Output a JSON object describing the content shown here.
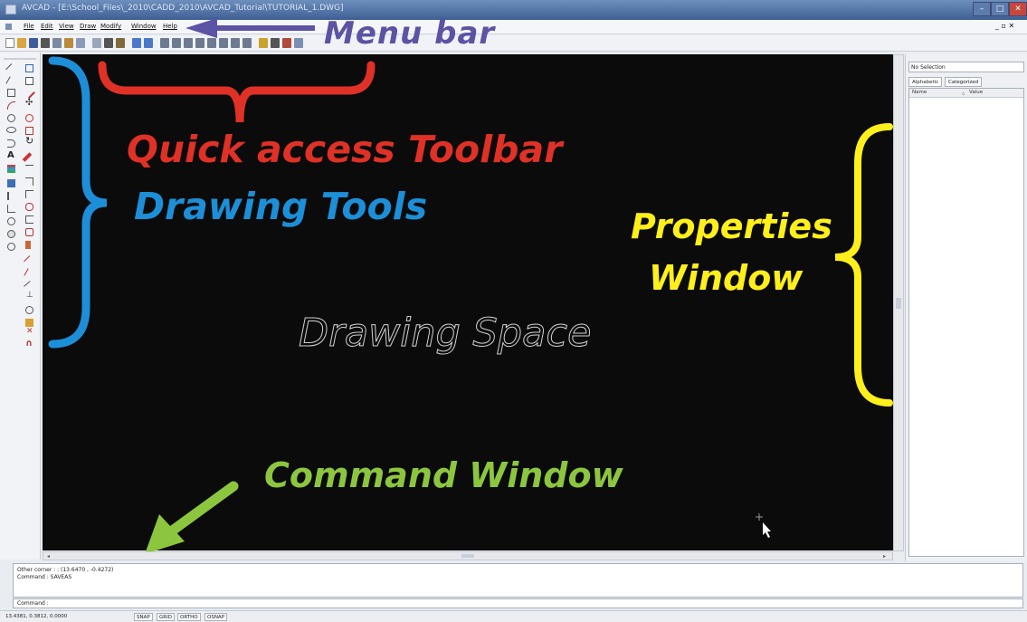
{
  "window": {
    "title": "AVCAD - [E:\\School_Files\\_2010\\CADD_2010\\AVCAD_Tutorial\\TUTORIAL_1.DWG]",
    "minimize": "–",
    "maximize": "□",
    "close": "✕"
  },
  "menubar": {
    "items": [
      "File",
      "Edit",
      "View",
      "Draw",
      "Modify",
      "Window",
      "Help"
    ],
    "doc_controls": "_ ▫ ✕"
  },
  "annotations": {
    "menu_bar": "Menu bar",
    "quick_access": "Quick access Toolbar",
    "drawing_tools": "Drawing Tools",
    "properties_line1": "Properties",
    "properties_line2": "Window",
    "drawing_space": "Drawing Space",
    "command_window": "Command Window"
  },
  "properties": {
    "selection": "No Selection",
    "tabs": [
      "Alphabetic",
      "Categorized"
    ],
    "columns": [
      "Name",
      "Value"
    ]
  },
  "command": {
    "history": [
      "Other corner : : (13.6470 , -0.4272)",
      "Command : SAVEAS"
    ],
    "prompt": "Command :"
  },
  "status": {
    "coords": "13.4381, 0.3812, 0.0000",
    "toggles": [
      "SNAP",
      "GRID",
      "ORTHO",
      "OSNAP"
    ]
  },
  "colors": {
    "menu_annotation": "#5b53a3",
    "quick_access": "#e03127",
    "drawing_tools": "#1c8fd8",
    "properties": "#ffef1a",
    "command": "#8cc63f",
    "canvas": "#0b0b0b"
  }
}
